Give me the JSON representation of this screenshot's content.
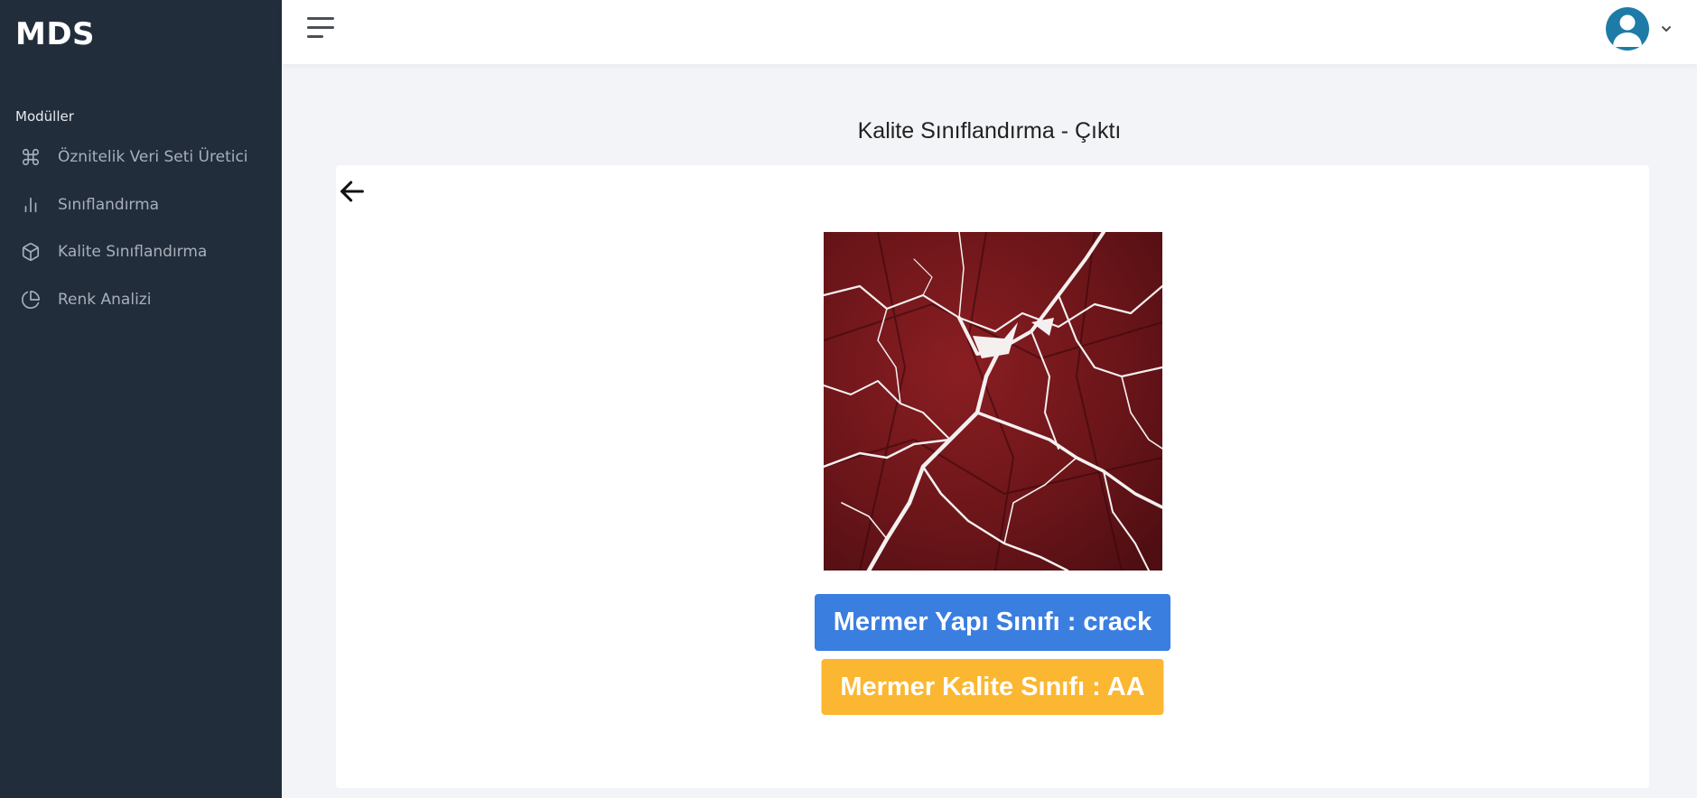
{
  "sidebar": {
    "brand": "MDS",
    "section_label": "Modüller",
    "items": [
      {
        "label": "Öznitelik Veri Seti Üretici",
        "icon": "command-icon"
      },
      {
        "label": "Sınıflandırma",
        "icon": "bar-chart-icon"
      },
      {
        "label": "Kalite Sınıflandırma",
        "icon": "box-icon"
      },
      {
        "label": "Renk Analizi",
        "icon": "pie-chart-icon"
      }
    ]
  },
  "header": {
    "menu_icon": "hamburger-icon",
    "avatar_icon": "user-avatar-icon",
    "dropdown_icon": "chevron-down-icon"
  },
  "main": {
    "title": "Kalite Sınıflandırma - Çıktı",
    "back_icon": "arrow-left-icon",
    "image_alt": "marble",
    "structure_result": "Mermer Yapı Sınıfı : crack",
    "quality_result": "Mermer Kalite Sınıfı : AA"
  },
  "colors": {
    "sidebar_bg": "#222d3c",
    "primary": "#3a7ee0",
    "warning": "#fbb731",
    "avatar": "#1e7ba7"
  }
}
